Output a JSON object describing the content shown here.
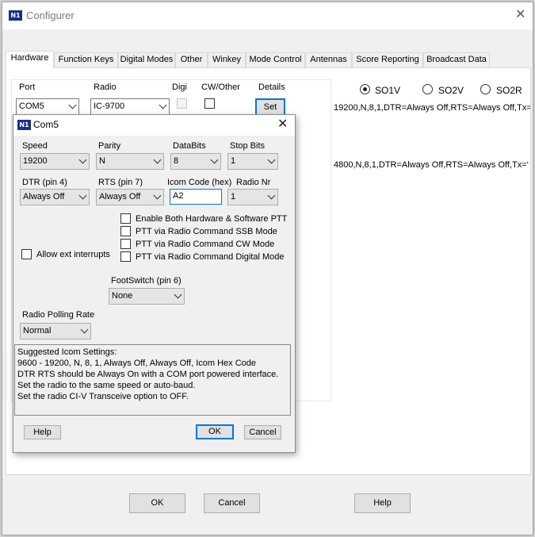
{
  "window": {
    "title": "Configurer",
    "icon": "n1mm-logo-icon",
    "close_glyph": "✕"
  },
  "tabs": [
    {
      "label": "Hardware",
      "active": true
    },
    {
      "label": "Function Keys"
    },
    {
      "label": "Digital Modes"
    },
    {
      "label": "Other"
    },
    {
      "label": "Winkey"
    },
    {
      "label": "Mode Control"
    },
    {
      "label": "Antennas"
    },
    {
      "label": "Score Reporting"
    },
    {
      "label": "Broadcast Data"
    }
  ],
  "hardware": {
    "headers": {
      "port": "Port",
      "radio": "Radio",
      "digi": "Digi",
      "cw_other": "CW/Other",
      "details": "Details"
    },
    "row1": {
      "port": "COM5",
      "radio": "IC-9700",
      "set_label": "Set"
    },
    "radios": [
      {
        "label": "SO1V",
        "selected": true
      },
      {
        "label": "SO2V",
        "selected": false
      },
      {
        "label": "SO2R",
        "selected": false
      }
    ],
    "info1": "19200,N,8,1,DTR=Always Off,RTS=Always Off,Tx=",
    "info2": "4800,N,8,1,DTR=Always Off,RTS=Always Off,Tx=‘"
  },
  "buttons": {
    "ok": "OK",
    "cancel": "Cancel",
    "help": "Help"
  },
  "dialog": {
    "title": "Com5",
    "close_glyph": "✕",
    "speed": {
      "label": "Speed",
      "value": "19200"
    },
    "parity": {
      "label": "Parity",
      "value": "N"
    },
    "databits": {
      "label": "DataBits",
      "value": "8"
    },
    "stopbits": {
      "label": "Stop Bits",
      "value": "1"
    },
    "dtr": {
      "label": "DTR (pin 4)",
      "value": "Always Off"
    },
    "rts": {
      "label": "RTS (pin 7)",
      "value": "Always Off"
    },
    "icom": {
      "label": "Icom Code (hex)",
      "value": "A2"
    },
    "radio_nr": {
      "label": "Radio Nr",
      "value": "1"
    },
    "checks": [
      {
        "label": "Enable Both Hardware & Software PTT",
        "checked": false
      },
      {
        "label": "PTT via Radio Command SSB Mode",
        "checked": false
      },
      {
        "label": "PTT via Radio Command CW Mode",
        "checked": false
      },
      {
        "label": "PTT via Radio Command Digital Mode",
        "checked": false
      }
    ],
    "allow_ext": {
      "label": "Allow ext interrupts",
      "checked": false
    },
    "footswitch": {
      "label": "FootSwitch (pin 6)",
      "value": "None"
    },
    "polling": {
      "label": "Radio Polling Rate",
      "value": "Normal"
    },
    "memo_lines": [
      "Suggested Icom Settings:",
      "9600 - 19200,  N,  8,  1,  Always Off, Always Off,  Icom Hex Code",
      "DTR  RTS should be Always On with a COM port powered interface.",
      "Set the radio to the same speed or auto-baud.",
      "Set the radio CI-V Transceive option to OFF."
    ],
    "help": "Help",
    "ok": "OK",
    "cancel": "Cancel"
  }
}
